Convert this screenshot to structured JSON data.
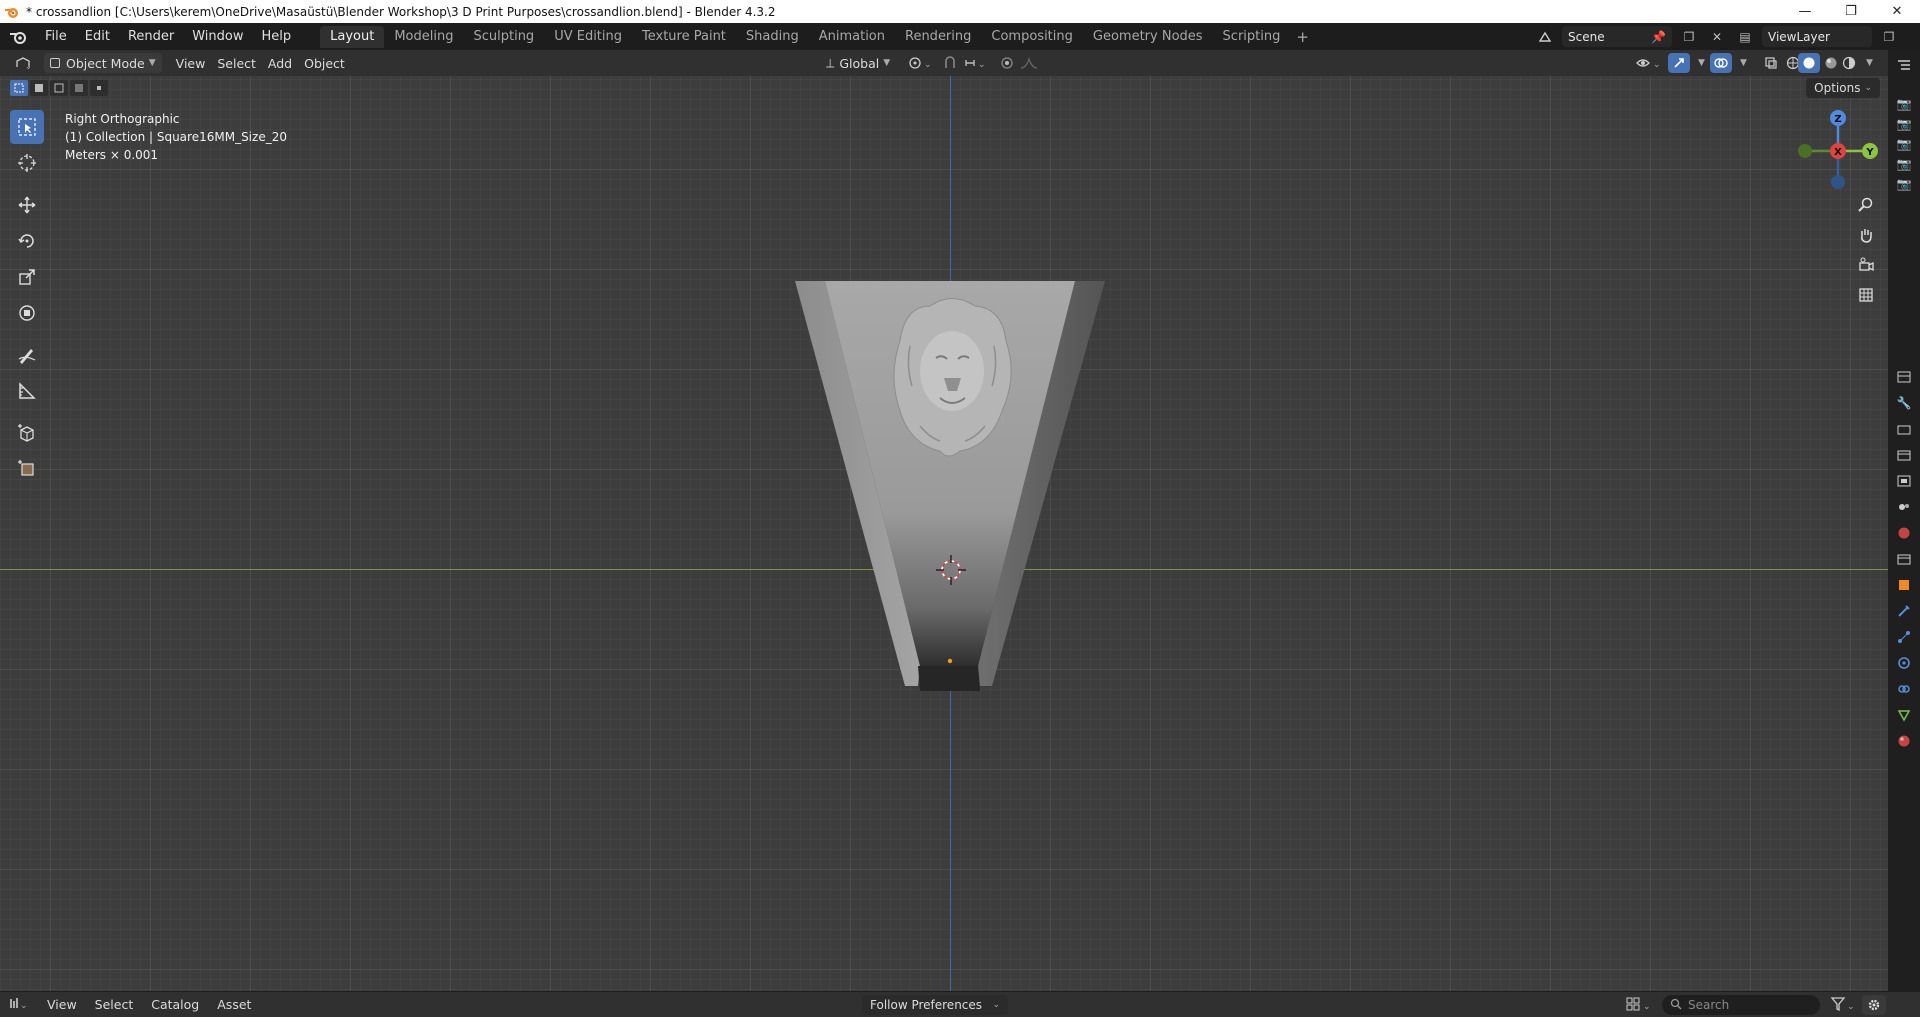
{
  "window": {
    "title": "* crossandlion [C:\\Users\\kerem\\OneDrive\\Masaüstü\\Blender Workshop\\3 D Print Purposes\\crossandlion.blend] - Blender 4.3.2",
    "minimize": "—",
    "maximize": "❐",
    "close": "✕"
  },
  "menu": {
    "items": [
      "File",
      "Edit",
      "Render",
      "Window",
      "Help"
    ]
  },
  "workspaces": {
    "tabs": [
      "Layout",
      "Modeling",
      "Sculpting",
      "UV Editing",
      "Texture Paint",
      "Shading",
      "Animation",
      "Rendering",
      "Compositing",
      "Geometry Nodes",
      "Scripting"
    ],
    "active": "Layout",
    "add": "+"
  },
  "scene": {
    "scene_name": "Scene",
    "view_layer": "ViewLayer"
  },
  "viewport_header": {
    "mode": "Object Mode",
    "menus": [
      "View",
      "Select",
      "Add",
      "Object"
    ],
    "orientation": "Global"
  },
  "viewport": {
    "view_name": "Right Orthographic",
    "collection_info": "(1) Collection | Square16MM_Size_20",
    "units": "Meters × 0.001",
    "options_label": "Options",
    "gizmo": {
      "z": "Z",
      "x": "X",
      "y": "Y"
    }
  },
  "bottom": {
    "menus": [
      "View",
      "Select",
      "Catalog",
      "Asset"
    ],
    "library_dropdown": "Follow Preferences",
    "search_placeholder": "Search"
  },
  "colors": {
    "accent": "#4772b3",
    "axis_x": "#e0443e",
    "axis_y": "#8bc43f",
    "axis_z": "#4f8be0",
    "grid_bg": "#3d3d3d"
  }
}
